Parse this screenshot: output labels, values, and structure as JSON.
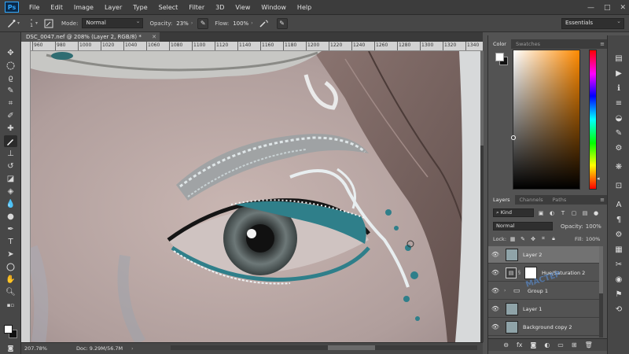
{
  "app": {
    "logo": "Ps"
  },
  "menu": [
    "File",
    "Edit",
    "Image",
    "Layer",
    "Type",
    "Select",
    "Filter",
    "3D",
    "View",
    "Window",
    "Help"
  ],
  "window_controls": {
    "minimize": "—",
    "maximize": "□",
    "close": "✕"
  },
  "options": {
    "brush_size": "1",
    "mode_label": "Mode:",
    "mode_value": "Normal",
    "opacity_label": "Opacity:",
    "opacity_value": "23%",
    "flow_label": "Flow:",
    "flow_value": "100%",
    "workspace": "Essentials"
  },
  "document": {
    "tab_title": "DSC_0047.nef @ 208% (Layer 2, RGB/8) *",
    "close": "✕"
  },
  "ruler": {
    "ticks": [
      "960",
      "980",
      "1000",
      "1020",
      "1040",
      "1060",
      "1080",
      "1100",
      "1120",
      "1140",
      "1160",
      "1180",
      "1200",
      "1220",
      "1240",
      "1260",
      "1280",
      "1300",
      "1320",
      "1340"
    ]
  },
  "status": {
    "zoom": "207.78%",
    "doc": "Doc: 9.29M/56.7M",
    "arrow": "›"
  },
  "color_panel": {
    "tabs": [
      "Color",
      "Swatches"
    ],
    "foreground": "#ffffff",
    "background": "#111111",
    "hue": "#ff8a00"
  },
  "layers_panel": {
    "tabs": [
      "Layers",
      "Channels",
      "Paths"
    ],
    "filter_kind": "Kind",
    "blend_mode": "Normal",
    "opacity_label": "Opacity:",
    "opacity_value": "100%",
    "lock_label": "Lock:",
    "fill_label": "Fill:",
    "fill_value": "100%",
    "layers": [
      {
        "name": "Layer 2",
        "type": "pixel",
        "selected": true
      },
      {
        "name": "Hue/Saturation 2",
        "type": "adjustment",
        "selected": false
      },
      {
        "name": "Group 1",
        "type": "group",
        "selected": false
      },
      {
        "name": "Layer 1",
        "type": "pixel",
        "selected": false
      },
      {
        "name": "Background copy 2",
        "type": "pixel",
        "selected": false
      }
    ]
  },
  "watermark": "МАСТЕР"
}
